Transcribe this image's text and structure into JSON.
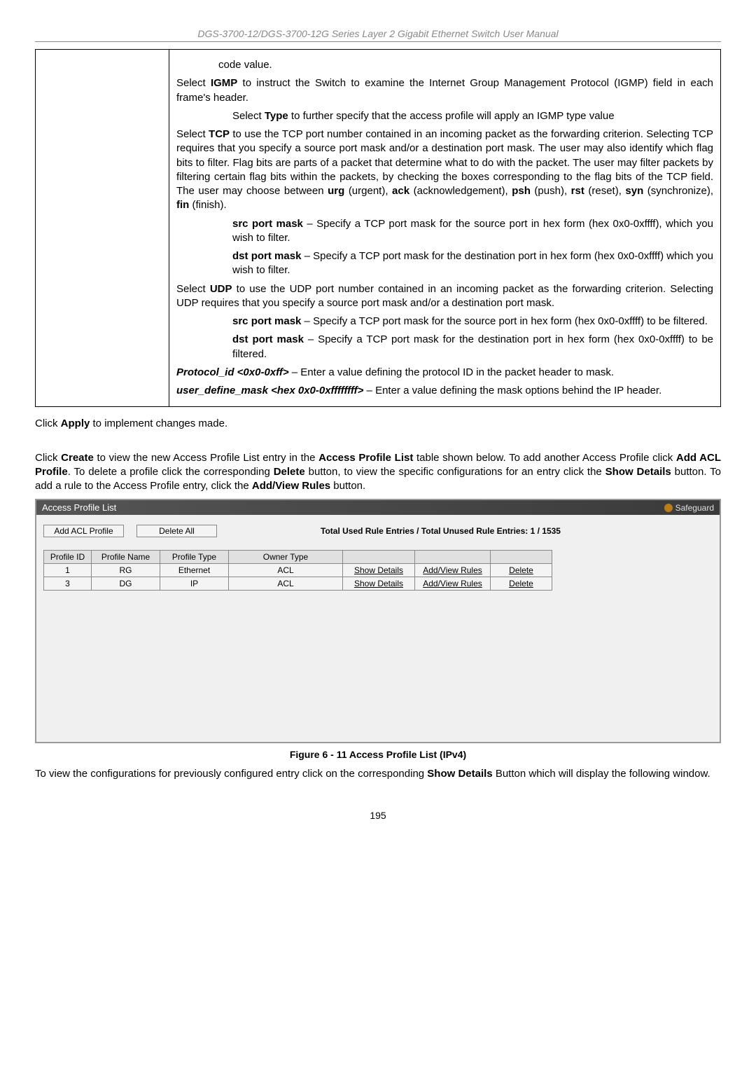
{
  "header": "DGS-3700-12/DGS-3700-12G Series Layer 2 Gigabit Ethernet Switch User Manual",
  "table_cell": {
    "code_value": "code value.",
    "igmp": {
      "p1a": "Select ",
      "b1": "IGMP",
      "p1b": " to instruct the Switch to examine the Internet Group Management Protocol (IGMP) field in each frame's header.",
      "sub_a": "Select ",
      "sub_b": "Type",
      "sub_c": " to further specify that the access profile will apply an IGMP type value"
    },
    "tcp": {
      "a": "Select ",
      "b1": "TCP",
      "c": " to use the TCP port number contained in an incoming packet as the forwarding criterion. Selecting TCP requires that you specify a source port mask and/or a destination port mask. The user may also identify which flag bits to filter. Flag bits are parts of a packet that determine what to do with the packet. The user may filter packets by filtering certain flag bits within the packets, by checking the boxes corresponding to the flag bits of the TCP field. The user may choose between ",
      "urg": "urg",
      "c2": " (urgent), ",
      "ack": "ack",
      "c3": " (acknowledgement), ",
      "psh": "psh",
      "c4": " (push), ",
      "rst": "rst",
      "c5": " (reset), ",
      "syn": "syn",
      "c6": " (synchronize), ",
      "fin": "fin",
      "c7": " (finish).",
      "src_b": "src port mask",
      "src_t": " – Specify a TCP port mask for the source port in hex form (hex 0x0-0xffff), which you wish to filter.",
      "dst_b": "dst port mask",
      "dst_t": " – Specify a TCP port mask for the destination port in hex form (hex 0x0-0xffff) which you wish to filter."
    },
    "udp": {
      "a": "Select ",
      "b": "UDP",
      "c": " to use the UDP port number contained in an incoming packet as the forwarding criterion. Selecting UDP requires that you specify a source port mask and/or a destination port mask.",
      "src_b": "src port mask",
      "src_t": " – Specify a TCP port mask for the source port in hex form (hex 0x0-0xffff) to be filtered.",
      "dst_b": "dst port mask",
      "dst_t": " – Specify a TCP port mask for the destination port in hex form (hex 0x0-0xffff) to be filtered."
    },
    "protocol_id": {
      "b": "Protocol_id <0x0-0xff>",
      "t": " – Enter a value defining the protocol ID in the packet header to mask."
    },
    "user_define": {
      "b": "user_define_mask <hex 0x0-0xffffffff>",
      "t": " – Enter a value defining the mask options behind the IP header."
    }
  },
  "apply_para": {
    "a": "Click ",
    "b": "Apply",
    "c": " to implement changes made."
  },
  "create_para": {
    "a": "Click ",
    "b1": "Create",
    "c1": " to view the new Access Profile List entry in the ",
    "b2": "Access Profile List",
    "c2": " table shown below. To add another Access Profile click ",
    "b3": "Add ACL Profile",
    "c3": ". To delete a profile click the corresponding ",
    "b4": "Delete",
    "c4": " button, to view the specific configurations for an entry click the ",
    "b5": "Show Details",
    "c5": " button. To add a rule to the Access Profile entry, click the ",
    "b6": "Add/View Rules",
    "c6": " button."
  },
  "screenshot": {
    "title": "Access Profile List",
    "safeguard": "Safeguard",
    "add_btn": "Add ACL Profile",
    "delete_all": "Delete All",
    "info": "Total Used Rule Entries / Total Unused Rule Entries: 1 / 1535",
    "headers": {
      "pid": "Profile ID",
      "pname": "Profile Name",
      "ptype": "Profile Type",
      "otype": "Owner Type"
    },
    "rows": [
      {
        "id": "1",
        "name": "RG",
        "type": "Ethernet",
        "owner": "ACL",
        "sd": "Show Details",
        "av": "Add/View Rules",
        "del": "Delete"
      },
      {
        "id": "3",
        "name": "DG",
        "type": "IP",
        "owner": "ACL",
        "sd": "Show Details",
        "av": "Add/View Rules",
        "del": "Delete"
      }
    ]
  },
  "figure_caption": "Figure 6 - 11 Access Profile List (IPv4)",
  "footer_para": {
    "a": "To view the configurations for previously configured entry click on the corresponding ",
    "b": "Show Details",
    "c": " Button which will display the following window."
  },
  "page_number": "195"
}
